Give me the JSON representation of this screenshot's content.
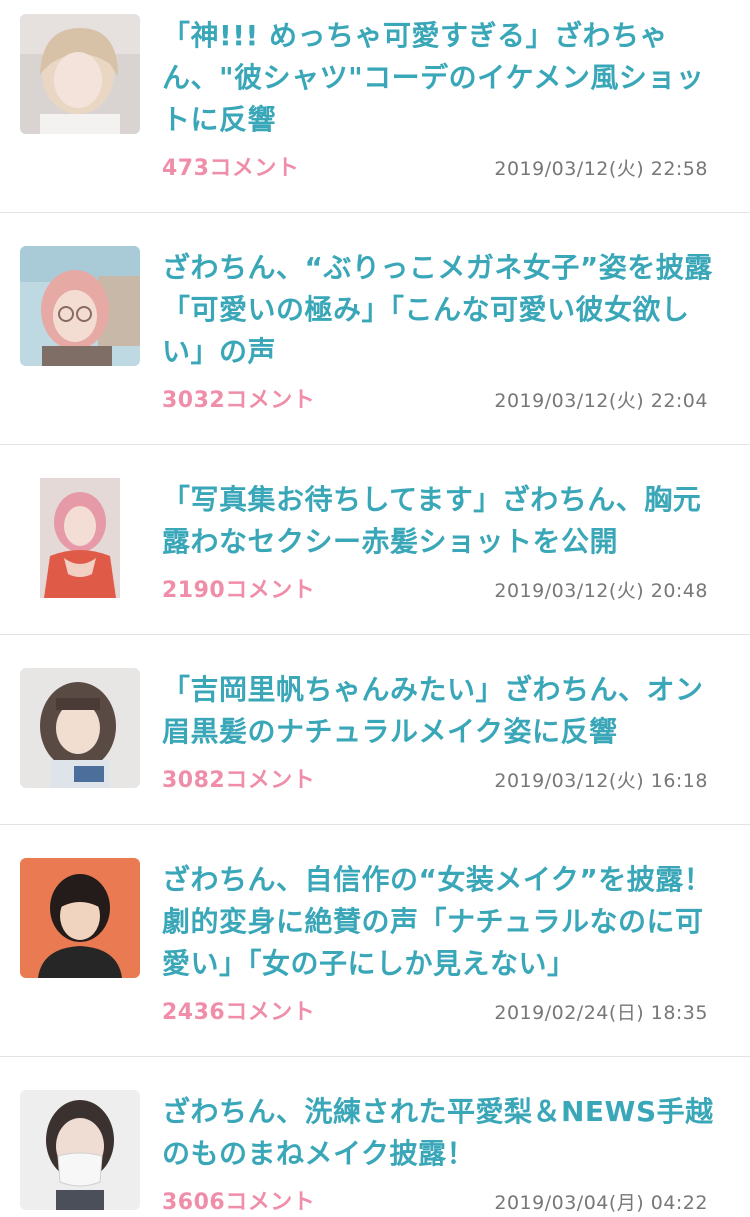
{
  "articles": [
    {
      "title": "「神!!! めっちゃ可愛すぎる」ざわちゃん、\"彼シャツ\"コーデのイケメン風ショットに反響",
      "comments": "473コメント",
      "date": "2019/03/12(火) 22:58"
    },
    {
      "title": "ざわちん、“ぶりっこメガネ女子”姿を披露「可愛いの極み」「こんな可愛い彼女欲しい」の声",
      "comments": "3032コメント",
      "date": "2019/03/12(火) 22:04"
    },
    {
      "title": "「写真集お待ちしてます」ざわちん、胸元露わなセクシー赤髪ショットを公開",
      "comments": "2190コメント",
      "date": "2019/03/12(火) 20:48"
    },
    {
      "title": "「吉岡里帆ちゃんみたい」ざわちん、オン眉黒髪のナチュラルメイク姿に反響",
      "comments": "3082コメント",
      "date": "2019/03/12(火) 16:18"
    },
    {
      "title": "ざわちん、自信作の“女装メイク”を披露！劇的変身に絶賛の声「ナチュラルなのに可愛い」「女の子にしか見えない」",
      "comments": "2436コメント",
      "date": "2019/02/24(日) 18:35"
    },
    {
      "title": "ざわちん、洗練された平愛梨＆NEWS手越のものまねメイク披露！",
      "comments": "3606コメント",
      "date": "2019/03/04(月) 04:22"
    }
  ]
}
